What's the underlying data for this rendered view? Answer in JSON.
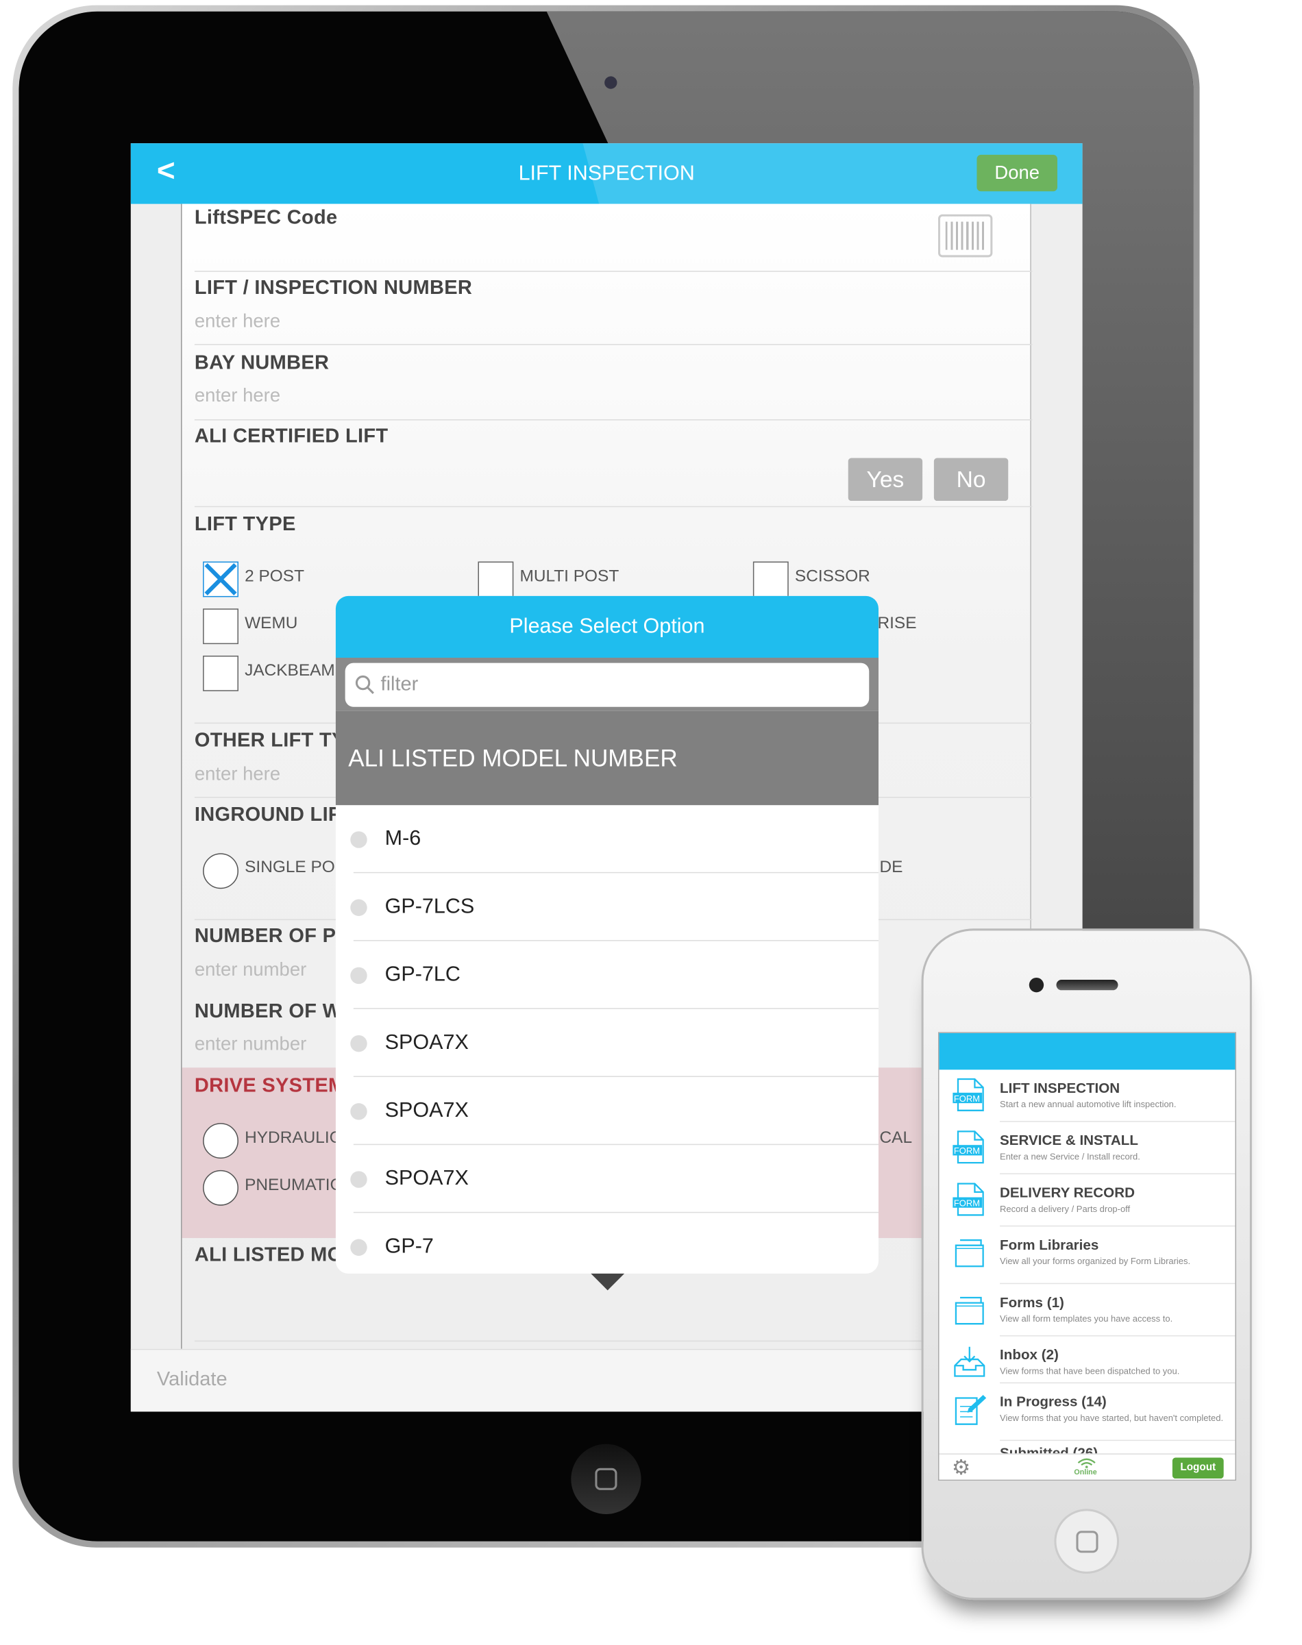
{
  "ipad": {
    "header": {
      "back_label": "<",
      "title": "LIFT INSPECTION",
      "done_label": "Done"
    },
    "form": {
      "liftspec_label": "LiftSPEC Code",
      "lift_number_label": "LIFT / INSPECTION NUMBER",
      "lift_number_placeholder": "enter here",
      "bay_label": "BAY NUMBER",
      "bay_placeholder": "enter here",
      "ali_certified_label": "ALI CERTIFIED LIFT",
      "yes_label": "Yes",
      "no_label": "No",
      "lift_type_label": "LIFT TYPE",
      "lift_types": [
        {
          "label": "2 POST",
          "checked": true
        },
        {
          "label": "MULTI POST",
          "checked": false
        },
        {
          "label": "SCISSOR",
          "checked": false
        },
        {
          "label": "WEMU",
          "checked": false
        },
        {
          "label": "RISE",
          "checked": false
        },
        {
          "label": "JACKBEAM",
          "checked": false
        }
      ],
      "other_lift_label": "OTHER LIFT TY",
      "other_lift_placeholder": "enter here",
      "inground_label": "INGROUND LIF",
      "inground_opt1": "SINGLE PO",
      "inground_opt2": "DE",
      "num_p_label": "NUMBER OF P",
      "num_p_placeholder": "enter number",
      "num_w_label": "NUMBER OF W",
      "num_w_placeholder": "enter number",
      "drive_label": "DRIVE SYSTEM",
      "drive_opt1": "HYDRAULIC",
      "drive_opt2": "PNEUMATIC",
      "drive_opt3": "CAL",
      "ali_listed_label": "ALI LISTED MO"
    },
    "validate_label": "Validate",
    "modal": {
      "title": "Please Select Option",
      "filter_placeholder": "filter",
      "section": "ALI LISTED MODEL NUMBER",
      "options": [
        "M-6",
        "GP-7LCS",
        "GP-7LC",
        "SPOA7X",
        "SPOA7X",
        "SPOA7X",
        "GP-7"
      ]
    }
  },
  "iphone": {
    "items": [
      {
        "title": "LIFT INSPECTION",
        "subtitle": "Start a new annual automotive lift inspection.",
        "icon": "form"
      },
      {
        "title": "SERVICE & INSTALL",
        "subtitle": "Enter a new Service / Install record.",
        "icon": "form"
      },
      {
        "title": "DELIVERY RECORD",
        "subtitle": "Record a delivery / Parts drop-off",
        "icon": "form"
      },
      {
        "title": "Form Libraries",
        "subtitle": "View all your forms organized by Form Libraries.",
        "icon": "folder"
      },
      {
        "title": "Forms (1)",
        "subtitle": "View all form templates you have access to.",
        "icon": "folder"
      },
      {
        "title": "Inbox (2)",
        "subtitle": "View forms that have been dispatched to you.",
        "icon": "inbox"
      },
      {
        "title": "In Progress (14)",
        "subtitle": "View forms that you have started, but haven't completed.",
        "icon": "edit"
      }
    ],
    "form_icon_label": "FORM",
    "partial_item": "Submitted (26)",
    "status": "Online",
    "logout_label": "Logout"
  },
  "colors": {
    "accent": "#1fbdee",
    "done": "#6db35e",
    "drive_bg": "#e6cfd3",
    "drive_label": "#b5353f"
  }
}
